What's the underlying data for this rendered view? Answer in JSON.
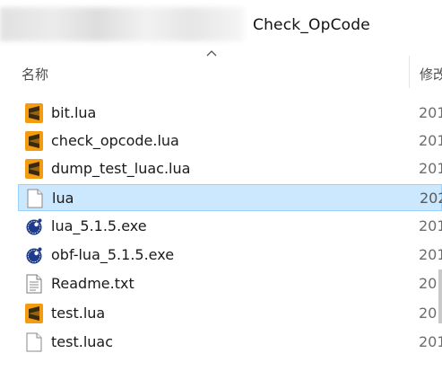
{
  "address_bar": {
    "folder_name": "Check_OpCode"
  },
  "columns": {
    "name": "名称",
    "modified": "修改"
  },
  "files": [
    {
      "name": "bit.lua",
      "date": "201",
      "icon": "sublime-file-icon",
      "selected": false
    },
    {
      "name": "check_opcode.lua",
      "date": "201",
      "icon": "sublime-file-icon",
      "selected": false
    },
    {
      "name": "dump_test_luac.lua",
      "date": "201",
      "icon": "sublime-file-icon",
      "selected": false
    },
    {
      "name": "lua",
      "date": "202",
      "icon": "blank-file-icon",
      "selected": true
    },
    {
      "name": "lua_5.1.5.exe",
      "date": "201",
      "icon": "lua-exe-icon",
      "selected": false
    },
    {
      "name": "obf-lua_5.1.5.exe",
      "date": "201",
      "icon": "lua-exe-icon",
      "selected": false
    },
    {
      "name": "Readme.txt",
      "date": "201",
      "icon": "text-file-icon",
      "selected": false
    },
    {
      "name": "test.lua",
      "date": "201",
      "icon": "sublime-file-icon",
      "selected": false
    },
    {
      "name": "test.luac",
      "date": "201",
      "icon": "blank-file-icon",
      "selected": false
    }
  ],
  "colors": {
    "selection_bg": "#cce8ff",
    "selection_border": "#99d1ff",
    "sublime_orange": "#f39c12",
    "lua_blue": "#1e3a8a"
  }
}
